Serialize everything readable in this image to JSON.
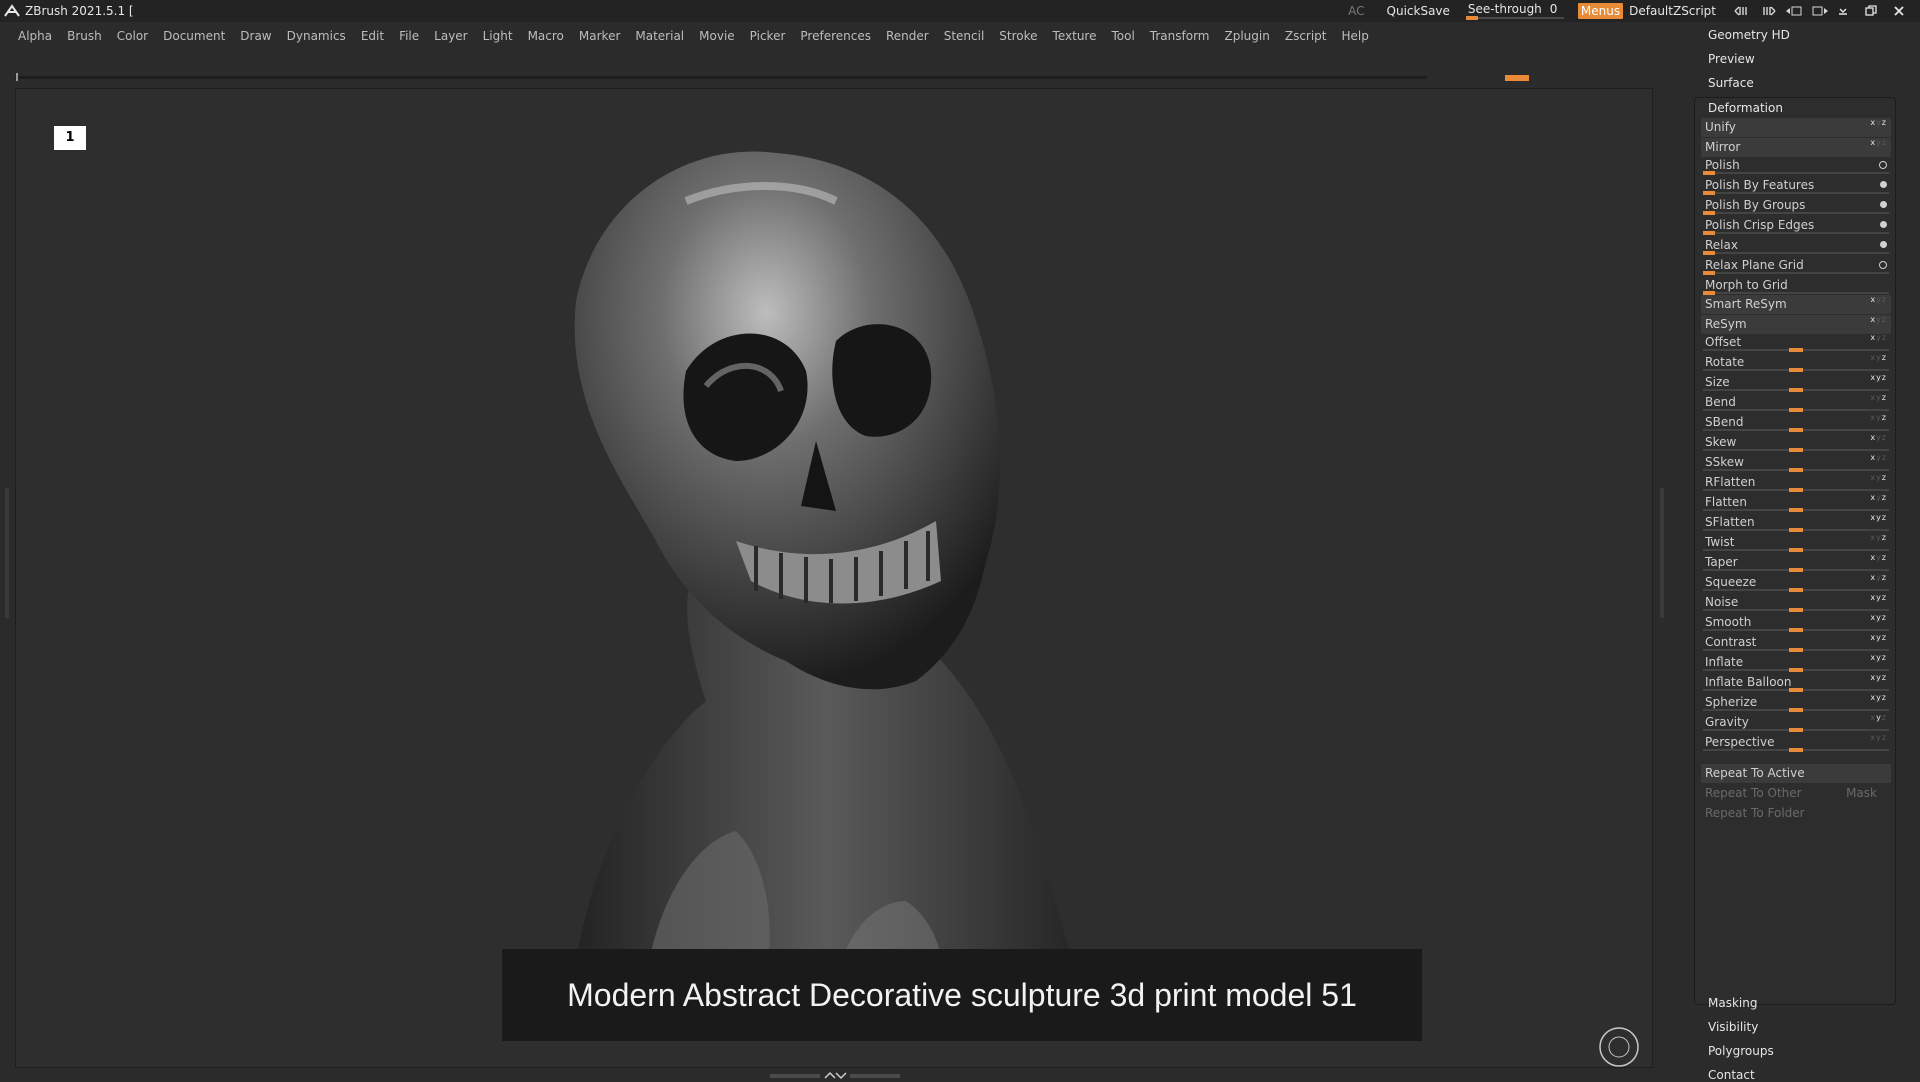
{
  "titlebar": {
    "app_title": "ZBrush 2021.5.1 [",
    "ac": "AC",
    "quicksave": "QuickSave",
    "seethrough_label": "See-through",
    "seethrough_value": "0",
    "seethrough_level": 0,
    "menus": "Menus",
    "script": "DefaultZScript"
  },
  "menus": [
    "Alpha",
    "Brush",
    "Color",
    "Document",
    "Draw",
    "Dynamics",
    "Edit",
    "File",
    "Layer",
    "Light",
    "Macro",
    "Marker",
    "Material",
    "Movie",
    "Picker",
    "Preferences",
    "Render",
    "Stencil",
    "Stroke",
    "Texture",
    "Tool",
    "Transform",
    "Zplugin",
    "Zscript",
    "Help"
  ],
  "viewport": {
    "layer_number": "1",
    "caption": "Modern Abstract Decorative sculpture 3d print model 51"
  },
  "panel": {
    "top_sections": [
      "Geometry HD",
      "Preview",
      "Surface"
    ],
    "deformation_title": "Deformation",
    "buttons_top": [
      "Unify",
      "Mirror"
    ],
    "polish_rows": [
      {
        "label": "Polish",
        "dot": "ring"
      },
      {
        "label": "Polish By Features",
        "dot": "solid"
      },
      {
        "label": "Polish By Groups",
        "dot": "solid"
      },
      {
        "label": "Polish Crisp Edges",
        "dot": "solid"
      },
      {
        "label": "Relax",
        "dot": "solid"
      },
      {
        "label": "Relax Plane Grid",
        "dot": "ring"
      },
      {
        "label": "Morph to Grid",
        "dot": ""
      }
    ],
    "buttons_mid": [
      "Smart ReSym",
      "ReSym"
    ],
    "sliders": [
      "Offset",
      "Rotate",
      "Size",
      "Bend",
      "SBend",
      "Skew",
      "SSkew",
      "RFlatten",
      "Flatten",
      "SFlatten",
      "Twist",
      "Taper",
      "Squeeze",
      "Noise",
      "Smooth",
      "Contrast",
      "Inflate",
      "Inflate Balloon",
      "Spherize",
      "Gravity",
      "Perspective"
    ],
    "repeat_active": "Repeat To Active",
    "repeat_other": "Repeat To Other",
    "mask": "Mask",
    "repeat_folder": "Repeat To Folder",
    "bottom_sections": [
      "Masking",
      "Visibility",
      "Polygroups",
      "Contact"
    ]
  },
  "colors": {
    "accent": "#e88a36",
    "background": "#2b2b2b",
    "panel_button": "#3b3b3b"
  }
}
